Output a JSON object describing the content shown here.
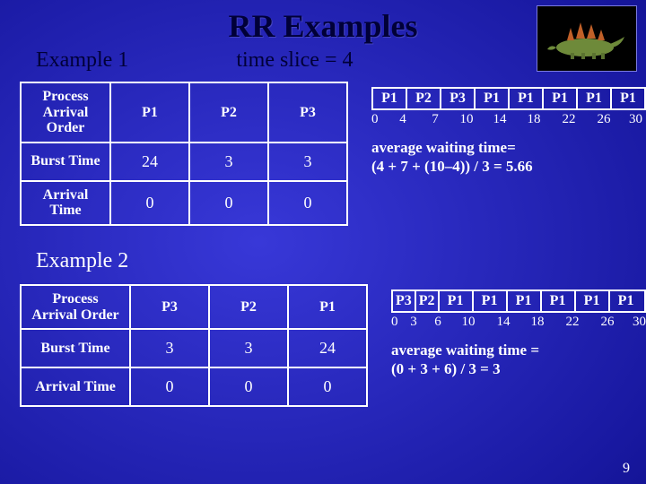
{
  "title": "RR Examples",
  "time_slice": "time slice = 4",
  "page_number": "9",
  "ex1": {
    "label": "Example 1",
    "table": {
      "row_headers": [
        "Process Arrival Order",
        "Burst Time",
        "Arrival Time"
      ],
      "cols": [
        "P1",
        "P2",
        "P3"
      ],
      "burst": [
        "24",
        "3",
        "3"
      ],
      "arrival": [
        "0",
        "0",
        "0"
      ]
    },
    "gantt": [
      "P1",
      "P2",
      "P3",
      "P1",
      "P1",
      "P1",
      "P1",
      "P1"
    ],
    "ticks": [
      "0",
      "4",
      "7",
      "10",
      "14",
      "18",
      "22",
      "26",
      "30"
    ],
    "avg_l1": "average waiting time=",
    "avg_l2": "(4 + 7 + (10–4)) / 3 = 5.66"
  },
  "ex2": {
    "label": "Example 2",
    "table": {
      "row_headers": [
        "Process Arrival Order",
        "Burst Time",
        "Arrival Time"
      ],
      "cols": [
        "P3",
        "P2",
        "P1"
      ],
      "burst": [
        "3",
        "3",
        "24"
      ],
      "arrival": [
        "0",
        "0",
        "0"
      ]
    },
    "gantt": [
      "P3",
      "P2",
      "P1",
      "P1",
      "P1",
      "P1",
      "P1",
      "P1"
    ],
    "ticks": [
      "0",
      "3",
      "6",
      "10",
      "14",
      "18",
      "22",
      "26",
      "30"
    ],
    "avg_l1": "average waiting time =",
    "avg_l2": "(0 + 3 + 6) / 3 = 3"
  }
}
